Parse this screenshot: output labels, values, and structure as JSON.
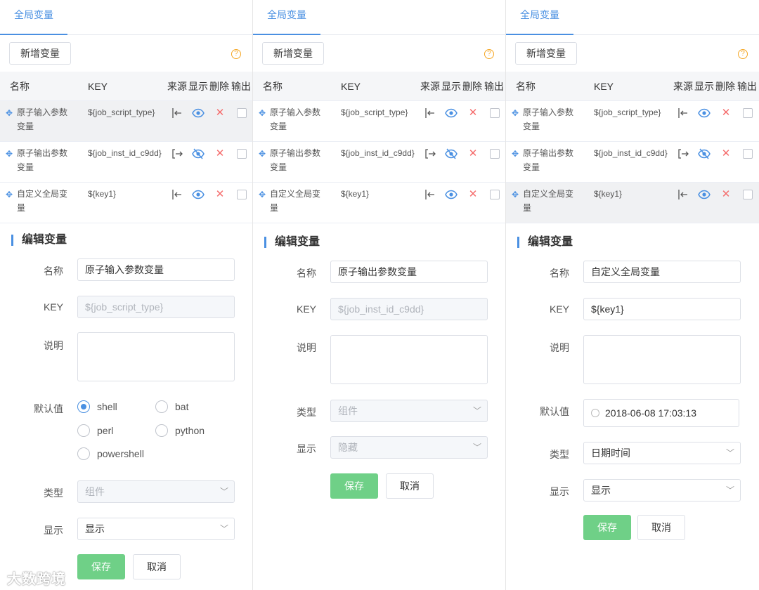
{
  "tab_label": "全局变量",
  "add_button_label": "新增变量",
  "help_glyph": "?",
  "columns": {
    "name": "名称",
    "key": "KEY",
    "source": "来源",
    "show": "显示",
    "delete": "删除",
    "output": "输出"
  },
  "rows": [
    {
      "name": "原子输入参数变量",
      "key": "${job_script_type}",
      "source_icon": "input-arrow-icon",
      "visible": true
    },
    {
      "name": "原子输出参数变量",
      "key": "${job_inst_id_c9dd}",
      "source_icon": "output-arrow-icon",
      "visible": false
    },
    {
      "name": "自定义全局变量",
      "key": "${key1}",
      "source_icon": "input-arrow-icon",
      "visible": true
    }
  ],
  "section_title": "编辑变量",
  "labels": {
    "name": "名称",
    "key": "KEY",
    "desc": "说明",
    "default": "默认值",
    "type": "类型",
    "display": "显示"
  },
  "save_label": "保存",
  "cancel_label": "取消",
  "panels": [
    {
      "selected_row": 0,
      "name_value": "原子输入参数变量",
      "key_value": "${job_script_type}",
      "default_options": [
        "shell",
        "bat",
        "perl",
        "python",
        "powershell"
      ],
      "default_selected": "shell",
      "type_value": "组件",
      "display_value": "显示"
    },
    {
      "selected_row": 1,
      "name_value": "原子输出参数变量",
      "key_value": "${job_inst_id_c9dd}",
      "type_value": "组件",
      "display_value": "隐藏"
    },
    {
      "selected_row": 2,
      "name_value": "自定义全局变量",
      "key_value": "${key1}",
      "default_value": "2018-06-08 17:03:13",
      "type_value": "日期时间",
      "display_value": "显示"
    }
  ],
  "watermark": "大数跨境",
  "colors": {
    "accent": "#4a90e2",
    "save": "#6fd087",
    "delete": "#f56c6c",
    "help": "#f5a623"
  }
}
